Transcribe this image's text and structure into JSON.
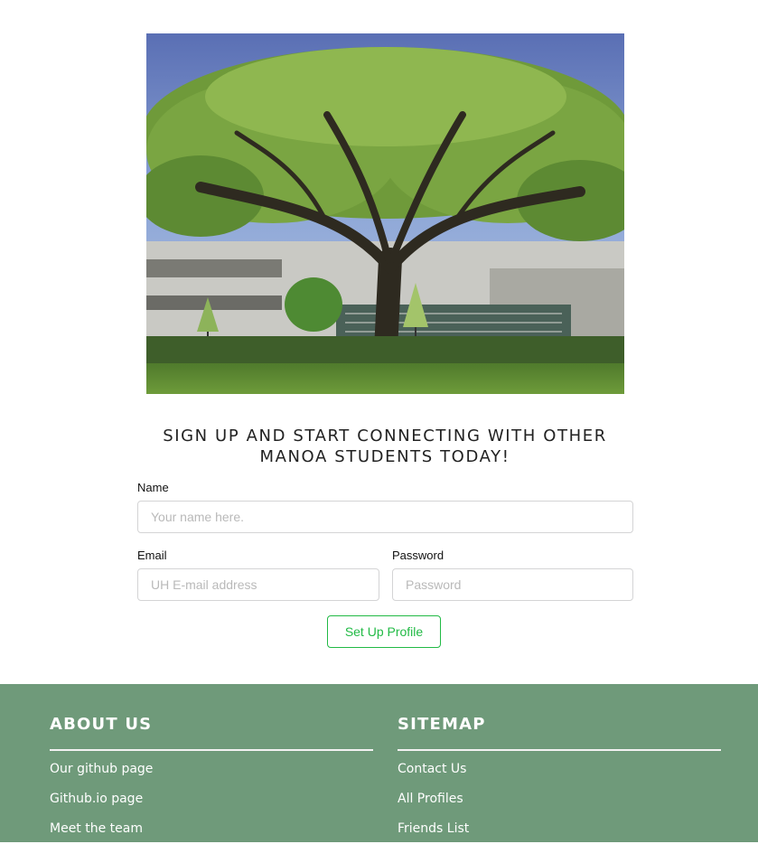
{
  "hero": {
    "image": "campus-tree-photo"
  },
  "headline": {
    "line1": "SIGN UP AND START CONNECTING WITH OTHER",
    "line2": "MANOA STUDENTS TODAY!"
  },
  "form": {
    "name_label": "Name",
    "name_placeholder": "Your name here.",
    "email_label": "Email",
    "email_placeholder": "UH E-mail address",
    "password_label": "Password",
    "password_placeholder": "Password",
    "submit_label": "Set Up Profile"
  },
  "footer": {
    "about": {
      "title": "ABOUT US",
      "links": [
        "Our github page",
        "Github.io page",
        "Meet the team"
      ]
    },
    "sitemap": {
      "title": "SITEMAP",
      "links": [
        "Contact Us",
        "All Profiles",
        "Friends List"
      ]
    }
  },
  "colors": {
    "accent_green": "#21ba45",
    "footer_bg": "#6f9a7a"
  }
}
